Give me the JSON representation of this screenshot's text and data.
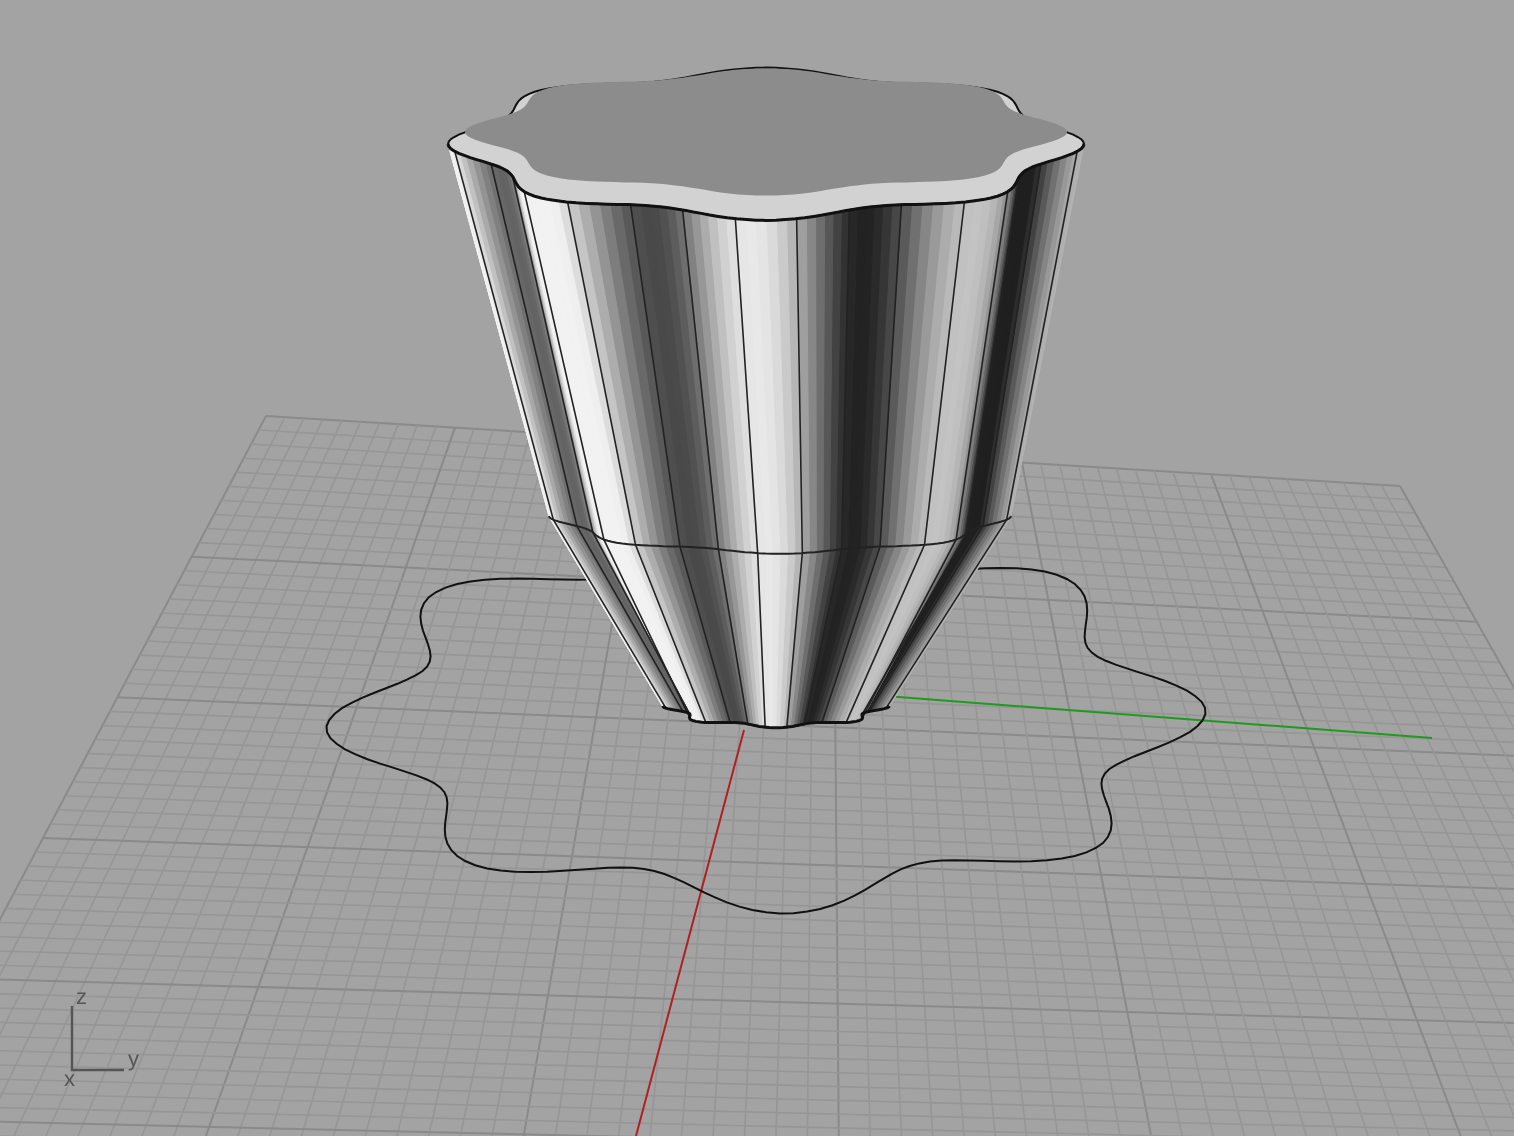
{
  "viewport": {
    "axis_labels": [
      {
        "text": "z"
      },
      {
        "text": "y"
      },
      {
        "text": "x"
      }
    ]
  }
}
